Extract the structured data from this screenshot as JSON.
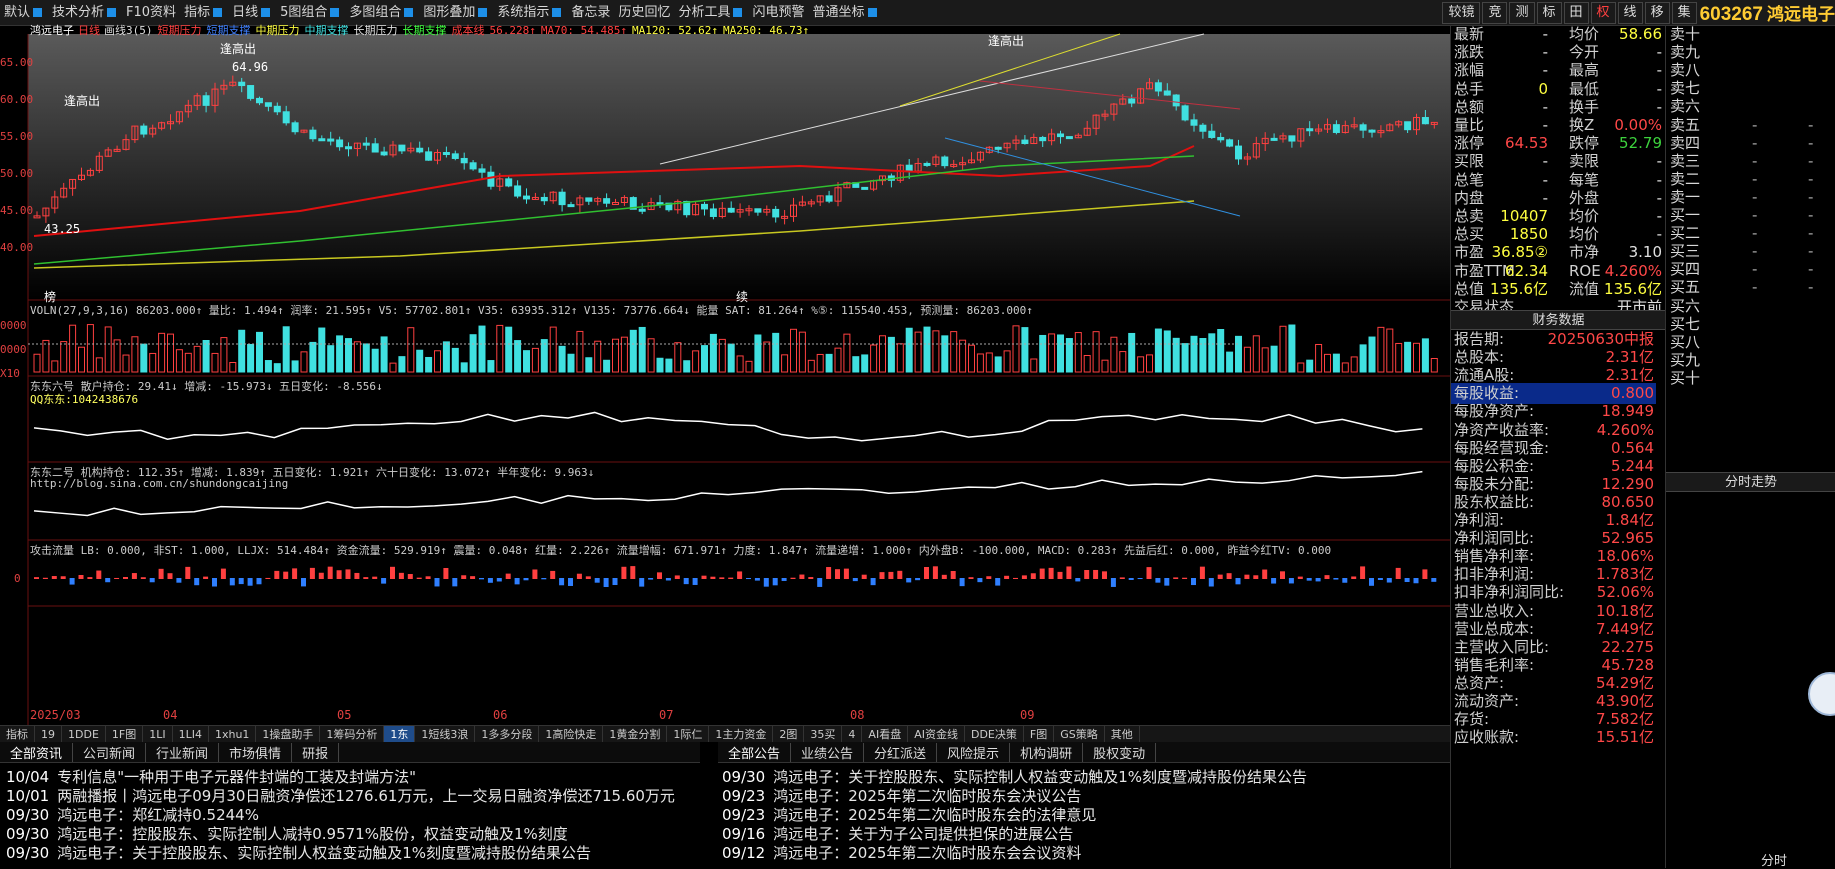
{
  "menubar": {
    "items": [
      {
        "label": "默认",
        "caret": true
      },
      {
        "label": "技术分析",
        "caret": true
      },
      {
        "label": "F10资料",
        "caret": false
      },
      {
        "label": "指标",
        "caret": true
      },
      {
        "label": "日线",
        "caret": true
      },
      {
        "label": "5图组合",
        "caret": true
      },
      {
        "label": "多图组合",
        "caret": true
      },
      {
        "label": "图形叠加",
        "caret": true
      },
      {
        "label": "系统指示",
        "caret": true
      },
      {
        "label": "备忘录",
        "caret": false
      },
      {
        "label": "历史回忆",
        "caret": false
      },
      {
        "label": "分析工具",
        "caret": true
      },
      {
        "label": "闪电预警",
        "caret": false
      },
      {
        "label": "普通坐标",
        "caret": true
      }
    ],
    "right_buttons": [
      "较镜",
      "竞",
      "测",
      "标",
      "田",
      "权",
      "线",
      "移",
      "集"
    ],
    "selected_button": "权",
    "stock_code": "603267",
    "stock_name": "鸿远电子"
  },
  "main_legend": {
    "title": "鸿远电子",
    "period": "日线",
    "draw_count": "画线3(5)",
    "items": [
      {
        "text": "短期压力",
        "color": "#ff4040"
      },
      {
        "text": "短期支撑",
        "color": "#4080ff"
      },
      {
        "text": "中期压力",
        "color": "#ffff40"
      },
      {
        "text": "中期支撑",
        "color": "#40e0e0"
      },
      {
        "text": "长期压力",
        "color": "#e0e0e0"
      },
      {
        "text": "长期支撑",
        "color": "#40ff40"
      },
      {
        "text": "成本线",
        "color": "#ff4040"
      },
      {
        "text": "56.228↑",
        "color": "#ff4040"
      },
      {
        "text": "MA70: 54.485↑",
        "color": "#ff4040"
      },
      {
        "text": "MA120: 52.62↑",
        "color": "#ffff40"
      },
      {
        "text": "MA250: 46.73↑",
        "color": "#ffff40"
      }
    ],
    "annotations": [
      "逢高出",
      "逢高出",
      "逢高出",
      "64.96",
      "43.25",
      "榜",
      "续"
    ]
  },
  "price_axis": [
    "65.00",
    "60.00",
    "55.00",
    "50.00",
    "45.00",
    "40.00"
  ],
  "vol_legend": "VOLN(27,9,3,16) 86203.000↑ 量比: 1.494↑ 润率: 21.595↑ V5: 57702.801↑ V35: 63935.312↑ V135: 73776.664↓ 能量 SAT: 81.264↑ %⑤: 115540.453, 预测量: 86203.000↑",
  "vol_axis": [
    "0000",
    "0000",
    "X10"
  ],
  "pane3_legend": "东东六号 散户持仓: 29.41↓ 增减: -15.973↓ 五日变化: -8.556↓",
  "pane3_sub": "QQ东东:1042438676",
  "pane4_legend": "东东二号 机构持仓: 112.35↑ 增减: 1.839↑ 五日变化: 1.921↑ 六十日变化: 13.072↑ 半年变化: 9.963↓",
  "pane4_sub": "http://blog.sina.com.cn/shundongcaijing",
  "pane5_legend": "攻击流量 LB: 0.000, 非ST: 1.000, LLJX: 514.484↑ 资金流量: 529.919↑ 震量: 0.048↑ 红量: 2.226↑ 流量增幅: 671.971↑ 力度: 1.847↑ 流量递增: 1.000↑ 内外盘B: -100.000, MACD: 0.283↑ 先益后红: 0.000, 昨益今红TV: 0.000",
  "pane5_axis": "0",
  "date_axis": [
    "2025/03",
    "04",
    "05",
    "06",
    "07",
    "08",
    "09"
  ],
  "bottom_tabs": [
    "指标",
    "19",
    "1DDE",
    "1F图",
    "1LI",
    "1LI4",
    "1xhu1",
    "1操盘助手",
    "1筹码分析",
    "1东",
    "1短线3浪",
    "1多多分段",
    "1高险快走",
    "1黄金分割",
    "1际仁",
    "1主力资金",
    "2图",
    "35买",
    "4",
    "AI看盘",
    "AI资金线",
    "DDE决策",
    "F图",
    "GS策略",
    "其他"
  ],
  "bottom_tab_active": "1东",
  "news_left": {
    "tabs": [
      "全部资讯",
      "公司新闻",
      "行业新闻",
      "市场俱情",
      "研报"
    ],
    "items": [
      {
        "date": "10/04",
        "text": "专利信息\"一种用于电子元器件封端的工装及封端方法\""
      },
      {
        "date": "10/01",
        "text": "两融播报丨鸿远电子09月30日融资净偿还1276.61万元，上一交易日融资净偿还715.60万元"
      },
      {
        "date": "09/30",
        "text": "鸿远电子：郑红减持0.5244%"
      },
      {
        "date": "09/30",
        "text": "鸿远电子：控股股东、实际控制人减持0.9571%股份，权益变动触及1%刻度"
      },
      {
        "date": "09/30",
        "text": "鸿远电子：关于控股股东、实际控制人权益变动触及1%刻度暨减持股份结果公告"
      }
    ]
  },
  "news_right": {
    "tabs": [
      "全部公告",
      "业绩公告",
      "分红派送",
      "风险提示",
      "机构调研",
      "股权变动"
    ],
    "items": [
      {
        "date": "09/30",
        "text": "鸿远电子：关于控股股东、实际控制人权益变动触及1%刻度暨减持股份结果公告"
      },
      {
        "date": "09/23",
        "text": "鸿远电子：2025年第二次临时股东会决议公告"
      },
      {
        "date": "09/23",
        "text": "鸿远电子：2025年第二次临时股东会的法律意见"
      },
      {
        "date": "09/16",
        "text": "鸿远电子：关于为子公司提供担保的进展公告"
      },
      {
        "date": "09/12",
        "text": "鸿远电子：2025年第二次临时股东会会议资料"
      }
    ]
  },
  "quote": {
    "rows": [
      {
        "l1": "最新",
        "v1": "-",
        "l2": "均价",
        "v2": "58.66"
      },
      {
        "l1": "涨跌",
        "v1": "-",
        "l2": "今开",
        "v2": "-"
      },
      {
        "l1": "涨幅",
        "v1": "-",
        "l2": "最高",
        "v2": "-"
      },
      {
        "l1": "总手",
        "v1": "0",
        "l2": "最低",
        "v2": "-"
      },
      {
        "l1": "总额",
        "v1": "-",
        "l2": "换手",
        "v2": "-"
      },
      {
        "l1": "量比",
        "v1": "-",
        "l2": "换Z",
        "v2": "0.00%"
      },
      {
        "l1": "涨停",
        "v1": "64.53",
        "l2": "跌停",
        "v2": "52.79"
      },
      {
        "l1": "买限",
        "v1": "-",
        "l2": "卖限",
        "v2": "-"
      },
      {
        "l1": "总笔",
        "v1": "-",
        "l2": "每笔",
        "v2": "-"
      },
      {
        "l1": "内盘",
        "v1": "-",
        "l2": "外盘",
        "v2": "-"
      },
      {
        "l1": "总卖",
        "v1": "10407",
        "l2": "均价",
        "v2": "-"
      },
      {
        "l1": "总买",
        "v1": "1850",
        "l2": "均价",
        "v2": "-"
      },
      {
        "l1": "市盈",
        "v1": "36.85②",
        "l2": "市净",
        "v2": "3.10"
      },
      {
        "l1": "市盈TTM",
        "v1": "62.34",
        "l2": "ROE",
        "v2": "4.260%"
      },
      {
        "l1": "总值",
        "v1": "135.6亿",
        "l2": "流值",
        "v2": "135.6亿"
      },
      {
        "l1": "交易状态",
        "v1": "",
        "l2": "",
        "v2": "开市前"
      }
    ],
    "fin_header": "财务数据",
    "fin_rows": [
      {
        "label": "报告期:",
        "value": "20250630中报"
      },
      {
        "label": "总股本:",
        "value": "2.31亿"
      },
      {
        "label": "流通A股:",
        "value": "2.31亿"
      },
      {
        "label": "每股收益:",
        "value": "0.800"
      },
      {
        "label": "每股净资产:",
        "value": "18.949"
      },
      {
        "label": "净资产收益率:",
        "value": "4.260%"
      },
      {
        "label": "每股经营现金:",
        "value": "0.564"
      },
      {
        "label": "每股公积金:",
        "value": "5.244"
      },
      {
        "label": "每股未分配:",
        "value": "12.290"
      },
      {
        "label": "股东权益比:",
        "value": "80.650"
      },
      {
        "label": "净利润:",
        "value": "1.84亿"
      },
      {
        "label": "净利润同比:",
        "value": "52.965"
      },
      {
        "label": "销售净利率:",
        "value": "18.06%"
      },
      {
        "label": "扣非净利润:",
        "value": "1.783亿"
      },
      {
        "label": "扣非净利润同比:",
        "value": "52.06%"
      },
      {
        "label": "营业总收入:",
        "value": "10.18亿"
      },
      {
        "label": "营业总成本:",
        "value": "7.449亿"
      },
      {
        "label": "主营收入同比:",
        "value": "22.275"
      },
      {
        "label": "销售毛利率:",
        "value": "45.728"
      },
      {
        "label": "总资产:",
        "value": "54.29亿"
      },
      {
        "label": "流动资产:",
        "value": "43.90亿"
      },
      {
        "label": "存货:",
        "value": "7.582亿"
      },
      {
        "label": "应收账款:",
        "value": "15.51亿"
      }
    ],
    "highlight_row": "每股收益:"
  },
  "book": {
    "sell": [
      "卖十",
      "卖九",
      "卖八",
      "卖七",
      "卖六",
      "卖五",
      "卖四",
      "卖三",
      "卖二",
      "卖一"
    ],
    "buy": [
      "买一",
      "买二",
      "买三",
      "买四",
      "买五",
      "买六",
      "买七",
      "买八",
      "买九",
      "买十"
    ],
    "fenshi_header": "分时走势",
    "bottom_tab": "分时"
  },
  "colors": {
    "up": "#ff4848",
    "down": "#40e0e0",
    "ma_red": "#e01010",
    "ma_green": "#30c030",
    "ma_yellow": "#c8c820",
    "accent": "#1d8fe8"
  }
}
